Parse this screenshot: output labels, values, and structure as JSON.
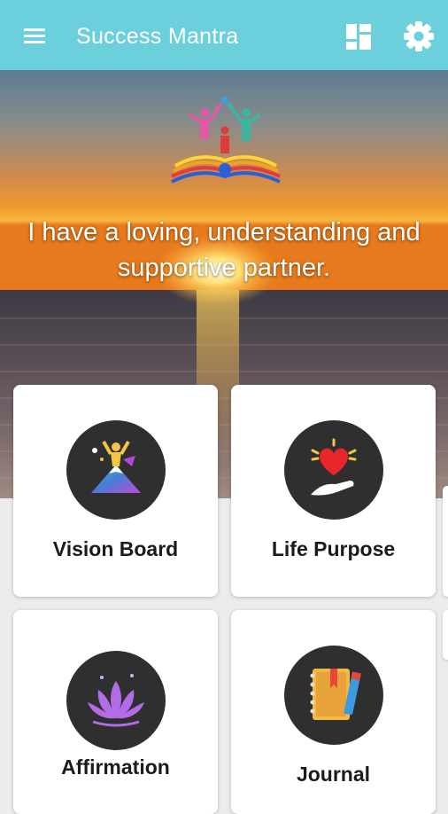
{
  "appbar": {
    "title": "Success Mantra",
    "menu_icon": "menu-icon",
    "dashboard_icon": "dashboard-icon",
    "settings_icon": "gear-icon",
    "color": "#6ccfdc"
  },
  "hero": {
    "quote": "I have a loving, understanding and supportive partner.",
    "logo_icon": "family-book-logo"
  },
  "cards": [
    {
      "label": "Vision Board",
      "icon": "mountain-summit-icon"
    },
    {
      "label": "Life Purpose",
      "icon": "heart-hand-icon"
    },
    {
      "label": "Affirmation",
      "icon": "lotus-icon"
    },
    {
      "label": "Journal",
      "icon": "notebook-pencil-icon"
    }
  ]
}
